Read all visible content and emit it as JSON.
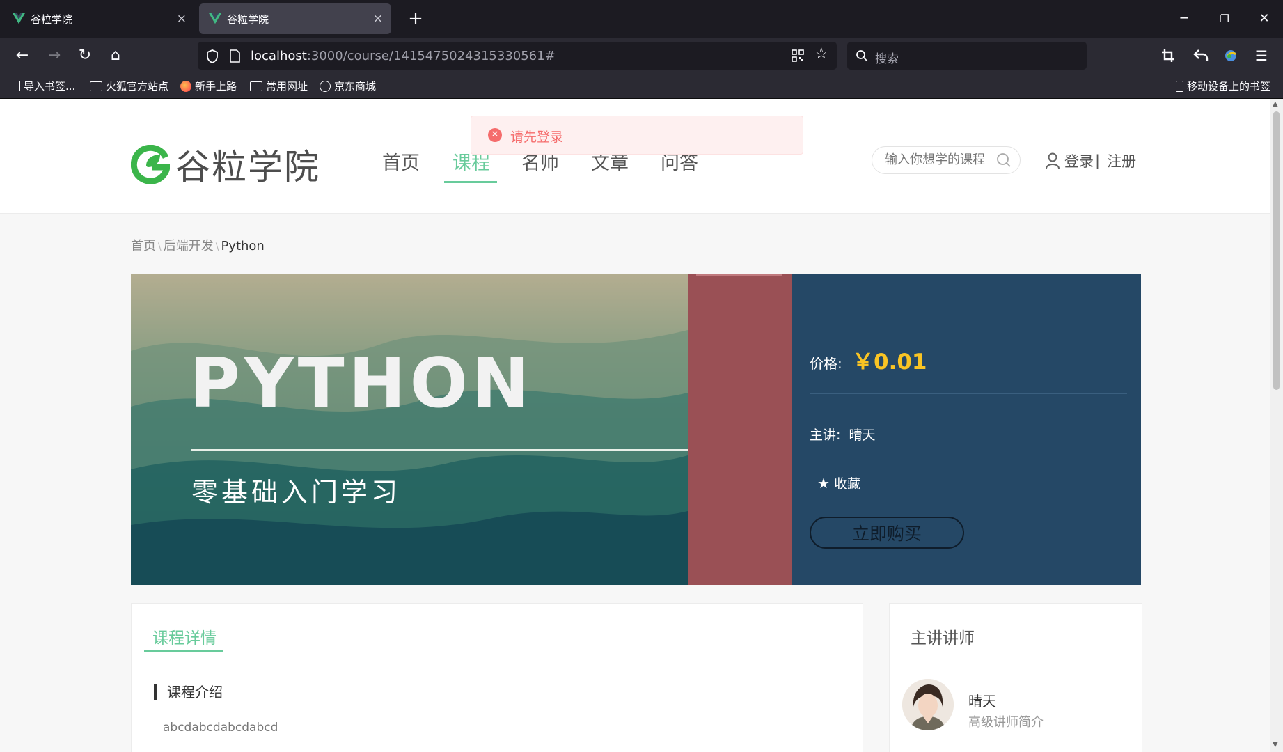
{
  "browser": {
    "tabs": [
      {
        "title": "谷粒学院",
        "close": "×"
      },
      {
        "title": "谷粒学院",
        "close": "×"
      }
    ],
    "new_tab": "+",
    "url_host": "localhost",
    "url_rest": ":3000/course/1415475024315330561#",
    "search_placeholder": "搜索",
    "bookmarks": [
      "导入书签...",
      "火狐官方站点",
      "新手上路",
      "常用网址",
      "京东商城"
    ],
    "mobile_bookmarks": "移动设备上的书签"
  },
  "site": {
    "logo_text": "谷粒学院",
    "nav": [
      "首页",
      "课程",
      "名师",
      "文章",
      "问答"
    ],
    "active_nav": "课程",
    "search_placeholder": "输入你想学的课程",
    "login": "登录",
    "login_sep": "|",
    "register": "注册",
    "toast_message": "请先登录"
  },
  "breadcrumb": {
    "home": "首页",
    "sep": "\\",
    "category": "后端开发",
    "current": "Python"
  },
  "course": {
    "cover_title": "PYTHON",
    "cover_subtitle": "零基础入门学习",
    "price_label": "价格:",
    "price": "￥0.01",
    "teacher_label": "主讲:",
    "teacher": "晴天",
    "favorite": "收藏",
    "buy": "立即购买"
  },
  "detail": {
    "tab": "课程详情",
    "section_title": "课程介绍",
    "intro": "abcdabcdabcdabcd"
  },
  "teacher_panel": {
    "title": "主讲讲师",
    "name": "晴天",
    "desc": "高级讲师简介"
  },
  "colors": {
    "accent_green": "#68cb9b",
    "price_yellow": "#f9c424",
    "info_panel": "#254866",
    "toast_red": "#f56c6c"
  }
}
